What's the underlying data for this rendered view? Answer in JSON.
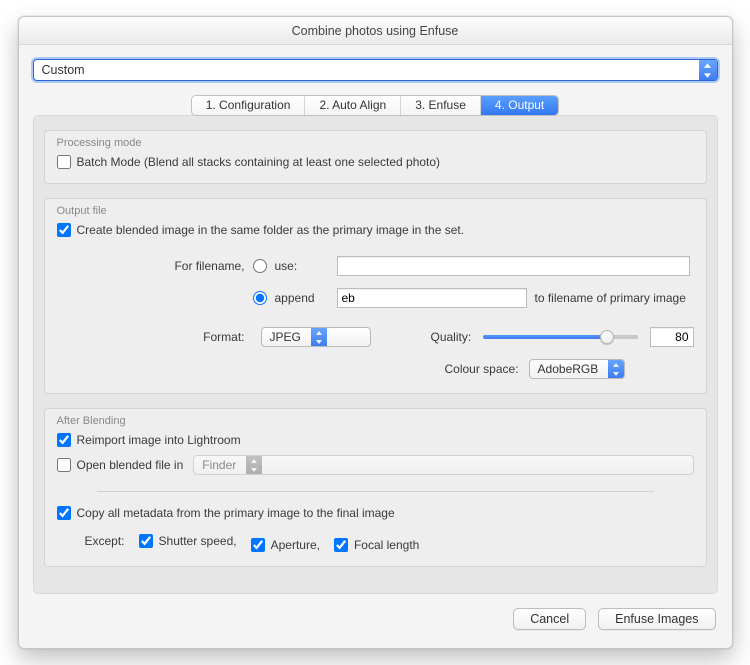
{
  "window": {
    "title": "Combine photos using Enfuse"
  },
  "preset": {
    "value": "Custom"
  },
  "tabs": {
    "items": [
      {
        "label": "1. Configuration"
      },
      {
        "label": "2. Auto Align"
      },
      {
        "label": "3. Enfuse"
      },
      {
        "label": "4. Output"
      }
    ],
    "active_index": 3
  },
  "processing_mode": {
    "legend": "Processing mode",
    "batch_checked": false,
    "batch_label": "Batch Mode (Blend all stacks containing at least one selected photo)"
  },
  "output_file": {
    "legend": "Output file",
    "same_folder_checked": true,
    "same_folder_label": "Create blended image in the same folder as the primary image in the set.",
    "for_filename_label": "For filename,",
    "radio_use_label": "use:",
    "radio_append_label": "append",
    "radio_selected": "append",
    "use_value": "",
    "append_value": "eb",
    "append_suffix": "to filename of primary image",
    "format_label": "Format:",
    "format_value": "JPEG",
    "quality_label": "Quality:",
    "quality_value": 80,
    "quality_min": 0,
    "quality_max": 100,
    "colour_space_label": "Colour space:",
    "colour_space_value": "AdobeRGB"
  },
  "after_blending": {
    "legend": "After Blending",
    "reimport_checked": true,
    "reimport_label": "Reimport image into Lightroom",
    "open_checked": false,
    "open_label": "Open blended file in",
    "open_app": "Finder",
    "copy_metadata_checked": true,
    "copy_metadata_label": "Copy all metadata from the primary image to the final image",
    "except_label": "Except:",
    "except_shutter_checked": true,
    "except_shutter_label": "Shutter speed,",
    "except_aperture_checked": true,
    "except_aperture_label": "Aperture,",
    "except_focal_checked": true,
    "except_focal_label": "Focal length"
  },
  "footer": {
    "cancel": "Cancel",
    "enfuse": "Enfuse Images"
  }
}
